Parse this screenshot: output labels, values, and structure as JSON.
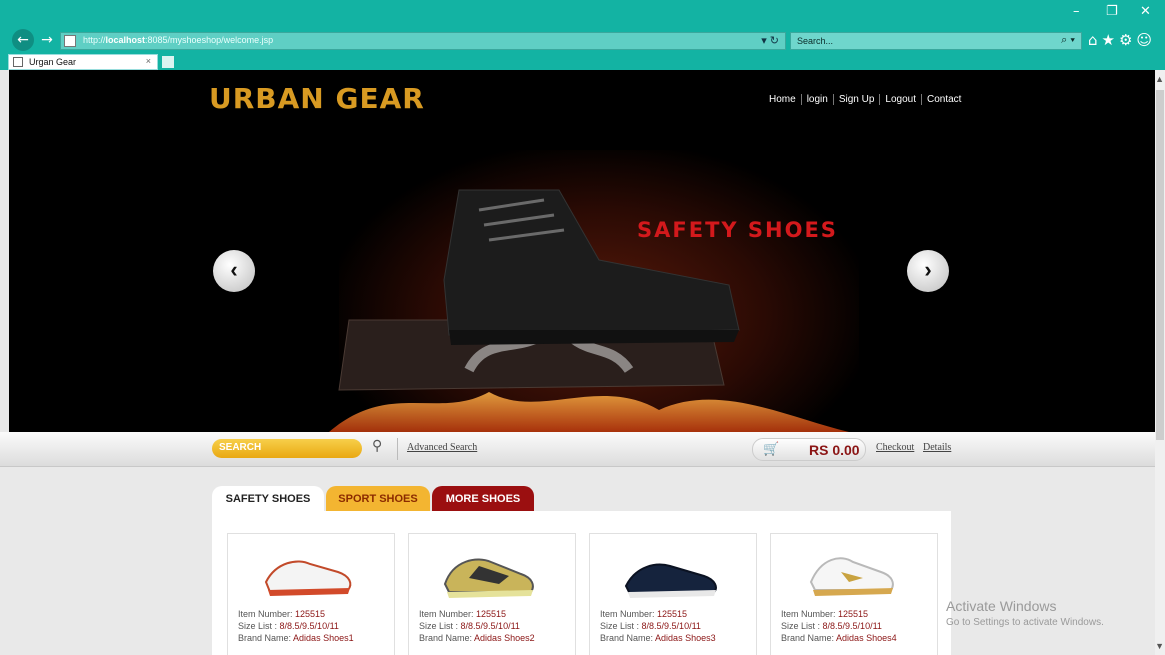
{
  "browser": {
    "url_prefix": "http://",
    "url_host": "localhost",
    "url_rest": ":8085/myshoeshop/welcome.jsp",
    "url_controls": "▾ ↻",
    "search_placeholder": "Search...",
    "search_icon_glyph": "⌕ ▾",
    "toolbar_glyphs": "⌂★⚙☺",
    "tab_title": "Urgan Gear",
    "tab_close": "×",
    "min_glyph": "–",
    "restore_glyph": "❐",
    "close_glyph": "✕",
    "back_glyph": "←",
    "forward_glyph": "→"
  },
  "header": {
    "logo": "URBAN GEAR",
    "nav": [
      "Home",
      "login",
      "Sign Up",
      "Logout",
      "Contact"
    ]
  },
  "slider": {
    "title": "SAFETY SHOES",
    "prev_glyph": "‹",
    "next_glyph": "›"
  },
  "searchbar": {
    "placeholder": "SEARCH",
    "advanced_label": "Advanced Search",
    "cart_total": "RS 0.00",
    "checkout_label": "Checkout",
    "details_label": "Details"
  },
  "tabs": [
    "SAFETY SHOES",
    "SPORT SHOES",
    "MORE SHOES"
  ],
  "products": [
    {
      "item_label": "Item Number:",
      "item_number": "125515",
      "size_label": "Size List :",
      "size_list": "8/8.5/9.5/10/11",
      "brand_label": "Brand Name:",
      "brand": "Adidas Shoes1"
    },
    {
      "item_label": "Item Number:",
      "item_number": "125515",
      "size_label": "Size List :",
      "size_list": "8/8.5/9.5/10/11",
      "brand_label": "Brand Name:",
      "brand": "Adidas Shoes2"
    },
    {
      "item_label": "Item Number:",
      "item_number": "125515",
      "size_label": "Size List :",
      "size_list": "8/8.5/9.5/10/11",
      "brand_label": "Brand Name:",
      "brand": "Adidas Shoes3"
    },
    {
      "item_label": "Item Number:",
      "item_number": "125515",
      "size_label": "Size List :",
      "size_list": "8/8.5/9.5/10/11",
      "brand_label": "Brand Name:",
      "brand": "Adidas Shoes4"
    }
  ],
  "watermark": {
    "line1": "Activate Windows",
    "line2": "Go to Settings to activate Windows."
  },
  "colors": {
    "chrome": "#13b3a3",
    "accent_red": "#9b0f10",
    "accent_gold": "#f3b531",
    "price_red": "#8b1515"
  }
}
